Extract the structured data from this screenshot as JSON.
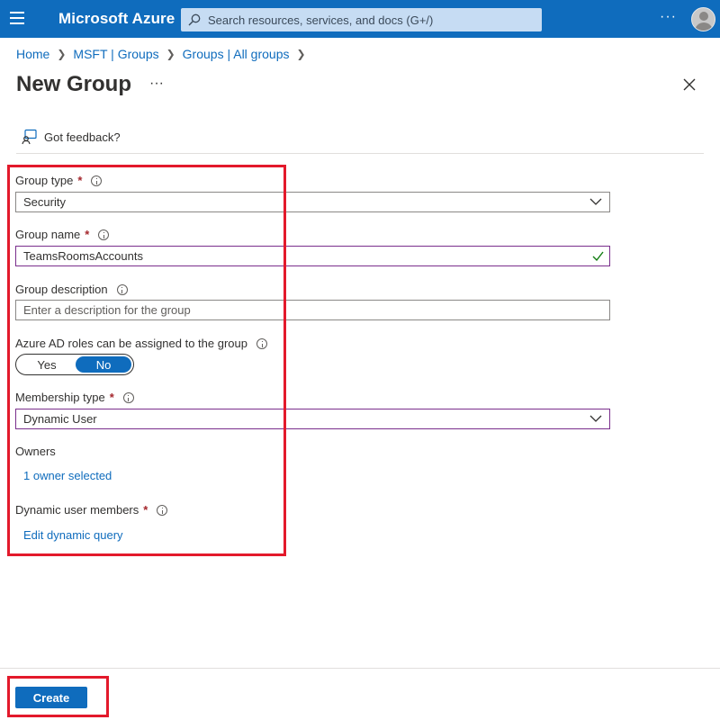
{
  "topbar": {
    "brand": "Microsoft Azure",
    "search_placeholder": "Search resources, services, and docs (G+/)",
    "more": "···"
  },
  "breadcrumb": [
    "Home",
    "MSFT | Groups",
    "Groups | All groups"
  ],
  "page": {
    "title": "New Group",
    "more": "···"
  },
  "feedback": "Got feedback?",
  "form": {
    "group_type": {
      "label": "Group type",
      "required": "*",
      "value": "Security"
    },
    "group_name": {
      "label": "Group name",
      "required": "*",
      "value": "TeamsRoomsAccounts"
    },
    "group_description": {
      "label": "Group description",
      "placeholder": "Enter a description for the group"
    },
    "aad_roles": {
      "label": "Azure AD roles can be assigned to the group",
      "yes": "Yes",
      "no": "No",
      "selected": "No"
    },
    "membership_type": {
      "label": "Membership type",
      "required": "*",
      "value": "Dynamic User"
    },
    "owners": {
      "label": "Owners",
      "link": "1 owner selected"
    },
    "dynamic_members": {
      "label": "Dynamic user members",
      "required": "*",
      "link": "Edit dynamic query"
    }
  },
  "footer": {
    "create": "Create"
  },
  "colors": {
    "accent": "#0f6cbd",
    "highlight": "#e3192b",
    "required": "#a4262c",
    "valid": "#107c10"
  }
}
